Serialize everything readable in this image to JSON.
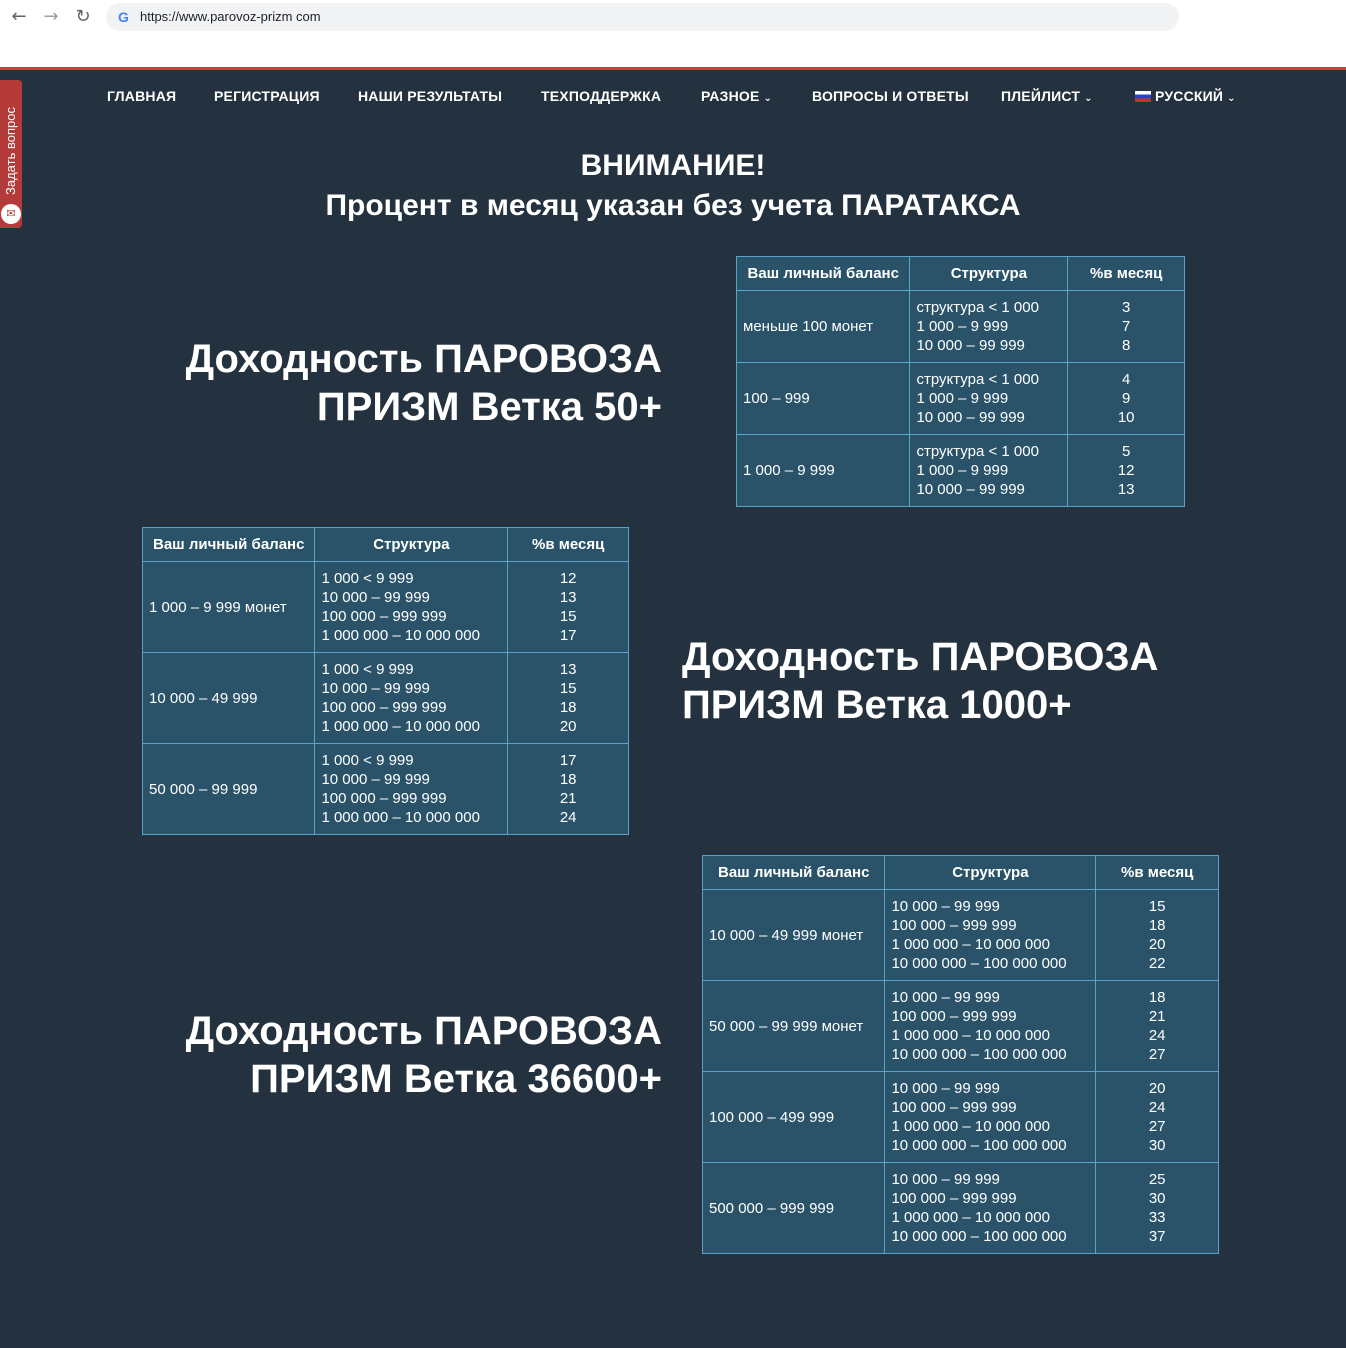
{
  "browser": {
    "url": "https://www.parovoz-prizm com"
  },
  "nav": {
    "items": [
      {
        "label": "ГЛАВНАЯ"
      },
      {
        "label": "РЕГИСТРАЦИЯ"
      },
      {
        "label": "НАШИ РЕЗУЛЬТАТЫ"
      },
      {
        "label": "ТЕХПОДДЕРЖКА"
      },
      {
        "label": "РАЗНОЕ"
      },
      {
        "label": "ВОПРОСЫ И ОТВЕТЫ"
      },
      {
        "label": "ПЛЕЙЛИСТ"
      },
      {
        "label": "РУССКИЙ"
      }
    ]
  },
  "side_tab": {
    "label": "Задать вопрос"
  },
  "attention": {
    "line1": "ВНИМАНИЕ!",
    "line2": "Процент в месяц указан без учета ПАРАТАКСА"
  },
  "headers": {
    "balance": "Ваш личный баланс",
    "structure": "Структура",
    "percent": "%в месяц"
  },
  "blocks": [
    {
      "title_line1": "Доходность ПАРОВОЗА",
      "title_line2": "ПРИЗМ Ветка 50+",
      "rows": [
        {
          "balance": "меньше 100 монет",
          "structure": [
            "структура < 1 000",
            "1 000 – 9 999",
            "10 000 – 99 999"
          ],
          "percent": [
            "3",
            "7",
            "8"
          ]
        },
        {
          "balance": "100 – 999",
          "structure": [
            "структура < 1 000",
            "1 000 – 9 999",
            "10 000 – 99 999"
          ],
          "percent": [
            "4",
            "9",
            "10"
          ]
        },
        {
          "balance": "1 000 – 9 999",
          "structure": [
            "структура < 1 000",
            "1 000 – 9 999",
            "10 000 – 99 999"
          ],
          "percent": [
            "5",
            "12",
            "13"
          ]
        }
      ]
    },
    {
      "title_line1": "Доходность ПАРОВОЗА",
      "title_line2": "ПРИЗМ Ветка 1000+",
      "rows": [
        {
          "balance": "1 000 – 9 999 монет",
          "structure": [
            "1 000 < 9 999",
            "10 000 – 99 999",
            "100 000 – 999 999",
            "1 000 000 – 10 000 000"
          ],
          "percent": [
            "12",
            "13",
            "15",
            "17"
          ]
        },
        {
          "balance": "10 000 – 49 999",
          "structure": [
            "1 000 < 9 999",
            "10 000 – 99 999",
            "100 000 – 999 999",
            "1 000 000 – 10 000 000"
          ],
          "percent": [
            "13",
            "15",
            "18",
            "20"
          ]
        },
        {
          "balance": "50 000 – 99 999",
          "structure": [
            "1 000 < 9 999",
            "10 000 – 99 999",
            "100 000 – 999 999",
            "1 000 000 – 10 000 000"
          ],
          "percent": [
            "17",
            "18",
            "21",
            "24"
          ]
        }
      ]
    },
    {
      "title_line1": "Доходность ПАРОВОЗА",
      "title_line2": "ПРИЗМ Ветка 36600+",
      "rows": [
        {
          "balance": "10 000 – 49 999 монет",
          "structure": [
            "10 000 – 99 999",
            "100 000 – 999 999",
            "1 000 000 – 10 000 000",
            "10 000 000 – 100 000 000"
          ],
          "percent": [
            "15",
            "18",
            "20",
            "22"
          ]
        },
        {
          "balance": "50 000 – 99 999 монет",
          "structure": [
            "10 000 – 99 999",
            "100 000 – 999 999",
            "1 000 000 – 10 000 000",
            "10 000 000 – 100 000 000"
          ],
          "percent": [
            "18",
            "21",
            "24",
            "27"
          ]
        },
        {
          "balance": "100 000 – 499 999",
          "structure": [
            "10 000 – 99 999",
            "100 000 – 999 999",
            "1 000 000 – 10 000 000",
            "10 000 000 – 100 000 000"
          ],
          "percent": [
            "20",
            "24",
            "27",
            "30"
          ]
        },
        {
          "balance": "500 000 – 999 999",
          "structure": [
            "10 000 – 99 999",
            "100 000 – 999 999",
            "1 000 000 – 10 000 000",
            "10 000 000 – 100 000 000"
          ],
          "percent": [
            "25",
            "30",
            "33",
            "37"
          ]
        }
      ]
    }
  ]
}
